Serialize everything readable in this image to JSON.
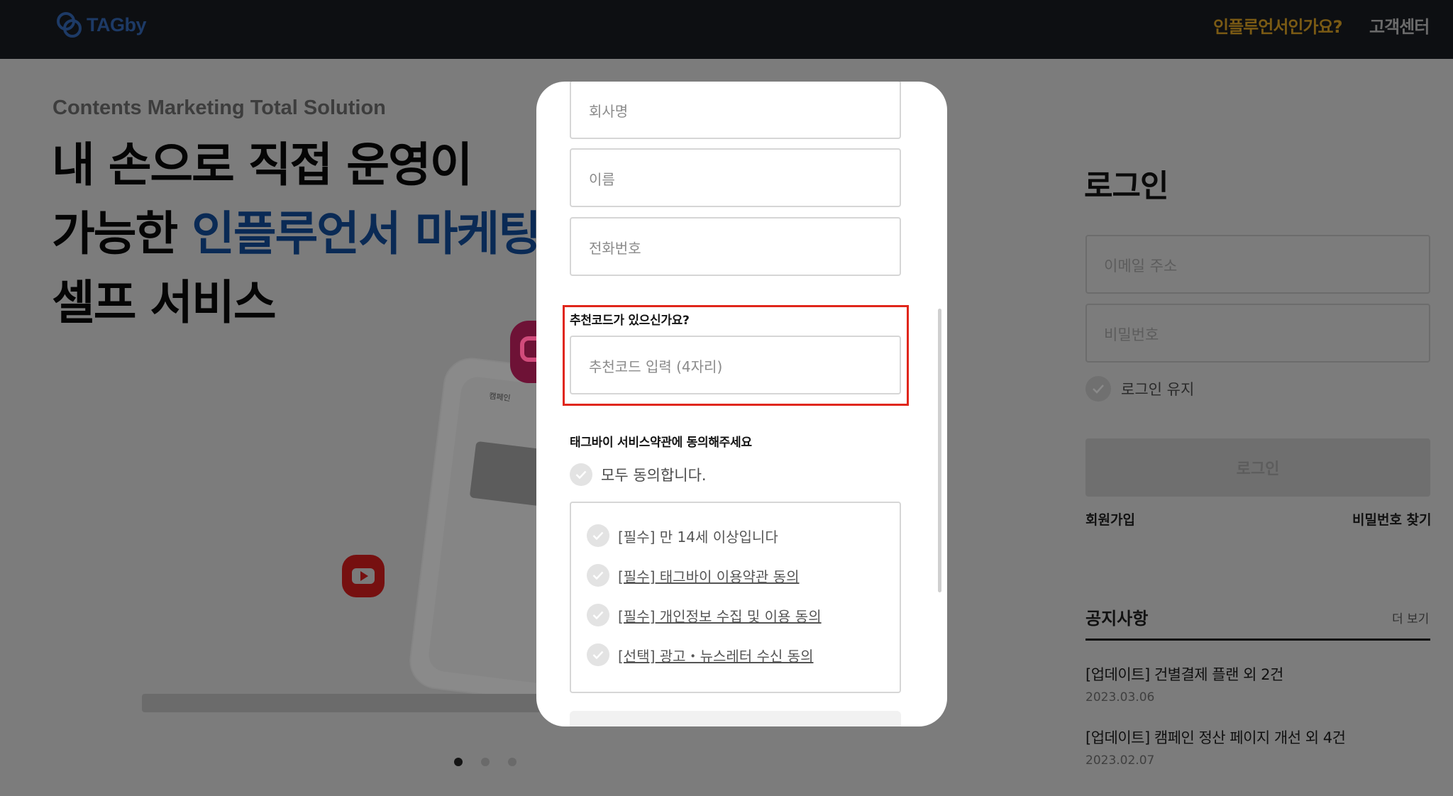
{
  "header": {
    "logo_text": "TAGby",
    "nav_influencer": "인플루언서인가요?",
    "nav_support": "고객센터"
  },
  "hero": {
    "tagline": "Contents Marketing Total Solution",
    "line1": "내 손으로 직접 운영이",
    "line2_prefix": "가능한 ",
    "line2_highlight": "인플루언서 마케팅",
    "line3": "셀프 서비스",
    "device_title": "캠페인",
    "slide_count": 3,
    "active_slide": 1
  },
  "login": {
    "title": "로그인",
    "email_placeholder": "이메일 주소",
    "password_placeholder": "비밀번호",
    "keep_login": "로그인 유지",
    "login_button": "로그인",
    "signup": "회원가입",
    "find_password": "비밀번호 찾기"
  },
  "notice": {
    "title": "공지사항",
    "more": "더 보기",
    "items": [
      {
        "title": "[업데이트] 건별결제 플랜 외 2건",
        "date": "2023.03.06"
      },
      {
        "title": "[업데이트] 캠페인 정산 페이지 개선 외 4건",
        "date": "2023.02.07"
      }
    ]
  },
  "modal": {
    "company_placeholder": "회사명",
    "name_placeholder": "이름",
    "phone_placeholder": "전화번호",
    "referral_label": "추천코드가 있으신가요?",
    "referral_placeholder": "추천코드 입력 (4자리)",
    "terms_heading": "태그바이 서비스약관에 동의해주세요",
    "agree_all": "모두 동의합니다.",
    "terms": [
      "[필수] 만 14세 이상입니다",
      "[필수] 태그바이 이용약관 동의",
      "[필수] 개인정보 수집 및 이용 동의",
      "[선택] 광고・뉴스레터 수신 동의"
    ]
  },
  "colors": {
    "overlay_bg": "#7c7c7c",
    "header_bg": "#0d0f12",
    "highlight_border": "#e0261b",
    "accent_blue": "#0a2a55"
  }
}
